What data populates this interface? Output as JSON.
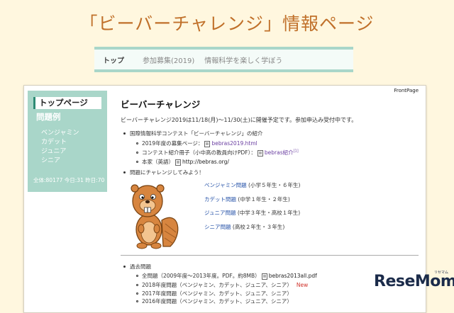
{
  "site": {
    "title": "「ビーバーチャレンジ」情報ページ"
  },
  "topnav": {
    "items": [
      "トップ",
      "参加募集(2019)",
      "情報科学を楽しく学ぼう"
    ]
  },
  "sidebar": {
    "top": "トップページ",
    "heading": "問題例",
    "items": [
      "ベンジャミン",
      "カデット",
      "ジュニア",
      "シニア"
    ],
    "counter": "全体:80177 今日:31 昨日:70"
  },
  "frontpage": "FrontPage",
  "main": {
    "title": "ビーバーチャレンジ",
    "notice": "ビーバーチャレンジ2019は11/18(月)～11/30(土)に開催予定です。参加申込み受付中です。",
    "intro": "国際情報科学コンテスト「ビーバーチャレンジ」の紹介",
    "sub1_text": "2019年度の募集ページ：",
    "sub1_link": "bebras2019.html",
    "sub2_text": "コンテスト紹介冊子（小中高の教員向けPDF）：",
    "sub2_link": "bebras紹介",
    "sub2_sup": "[1]",
    "sub3_text": "本家（英語）",
    "sub3_link": "http://bebras.org/",
    "challenge": "問題にチャレンジしてみよう！",
    "levels": [
      {
        "link": "ベンジャミン問題",
        "desc": "(小学５年生・６年生)"
      },
      {
        "link": "カデット問題",
        "desc": "(中学１年生・２年生)"
      },
      {
        "link": "ジュニア問題",
        "desc": "(中学３年生・高校１年生)"
      },
      {
        "link": "シニア問題",
        "desc": "(高校２年生・３年生)"
      }
    ],
    "past_heading": "過去問題",
    "past": [
      {
        "text": "全問題（2009年度～2013年度。PDF。約8MB）",
        "link": "bebras2013all.pdf"
      },
      {
        "text": "2018年度問題（ベンジャミン、カデット、ジュニア、シニア）",
        "new": "New"
      },
      {
        "text": "2017年度問題（ベンジャミン、カデット、ジュニア、シニア）"
      },
      {
        "text": "2016年度問題（ベンジャミン、カデット、ジュニア、シニア）"
      }
    ]
  },
  "logo": {
    "text": "ReseMom",
    "small": "リセマム"
  }
}
